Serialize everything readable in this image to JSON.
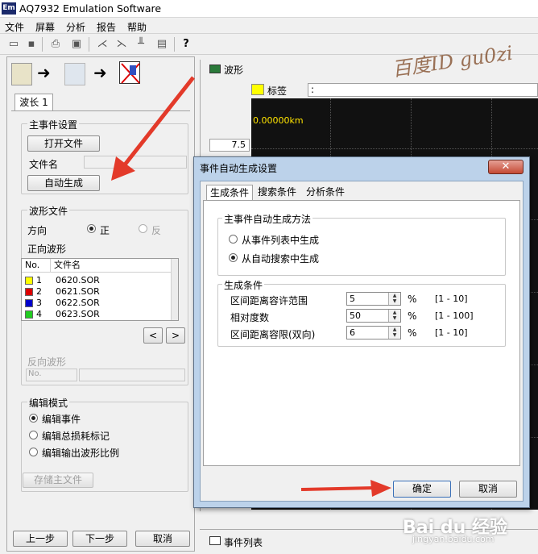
{
  "app": {
    "icon_text": "Em",
    "title": "AQ7932 Emulation Software"
  },
  "menu": [
    "文件",
    "屏幕",
    "分析",
    "报告",
    "帮助"
  ],
  "left": {
    "tab_label": "波长 1",
    "main_event_group": "主事件设置",
    "open_file_button": "打开文件",
    "file_name_label": "文件名",
    "auto_generate_button": "自动生成",
    "wave_group": "波形文件",
    "direction_label": "方向",
    "direction_forward": "正",
    "direction_reverse": "反",
    "forward_wave_label": "正向波形",
    "list_headers": [
      "No.",
      "文件名"
    ],
    "files": [
      {
        "no": "1",
        "name": "0620.SOR",
        "color": "#ffff00"
      },
      {
        "no": "2",
        "name": "0621.SOR",
        "color": "#dd0000"
      },
      {
        "no": "3",
        "name": "0622.SOR",
        "color": "#0000cc"
      },
      {
        "no": "4",
        "name": "0623.SOR",
        "color": "#22cc22"
      }
    ],
    "prev_button": "<",
    "next_button": ">",
    "reverse_wave_label": "反向波形",
    "reverse_no_placeholder": "No.",
    "edit_mode_group": "编辑模式",
    "edit_modes": [
      "编辑事件",
      "编辑总损耗标记",
      "编辑输出波形比例"
    ],
    "save_main_file_button": "存储主文件",
    "back_button": "上一步",
    "forward_button": "下一步",
    "cancel_button": "取消"
  },
  "waveform": {
    "window_title": "波形",
    "label_text": "标签",
    "label_sep": ":",
    "distance_readout": "0.00000km",
    "y_value": "7.5",
    "watermark": "百度ID  gu0zi"
  },
  "event_list": {
    "title": "事件列表"
  },
  "dialog": {
    "title": "事件自动生成设置",
    "close_symbol": "✕",
    "tabs": [
      "生成条件",
      "搜索条件",
      "分析条件"
    ],
    "method_group": "主事件自动生成方法",
    "methods": [
      "从事件列表中生成",
      "从自动搜索中生成"
    ],
    "selected_method": 1,
    "conditions_group": "生成条件",
    "conditions": [
      {
        "label": "区间距离容许范围",
        "value": "5",
        "unit": "%",
        "range": "[1 - 10]"
      },
      {
        "label": "相对度数",
        "value": "50",
        "unit": "%",
        "range": "[1 - 100]"
      },
      {
        "label": "区间距离容限(双向)",
        "value": "6",
        "unit": "%",
        "range": "[1 - 10]"
      }
    ],
    "ok_button": "确定",
    "cancel_button": "取消"
  },
  "footer_watermark": {
    "brand": "Bai du 经验",
    "url": "jingyan.baidu.com"
  },
  "colors": {
    "accent_arrow": "#e33a2a",
    "plot_bg": "#111111",
    "dialog_frame": "#bcd2ea"
  }
}
